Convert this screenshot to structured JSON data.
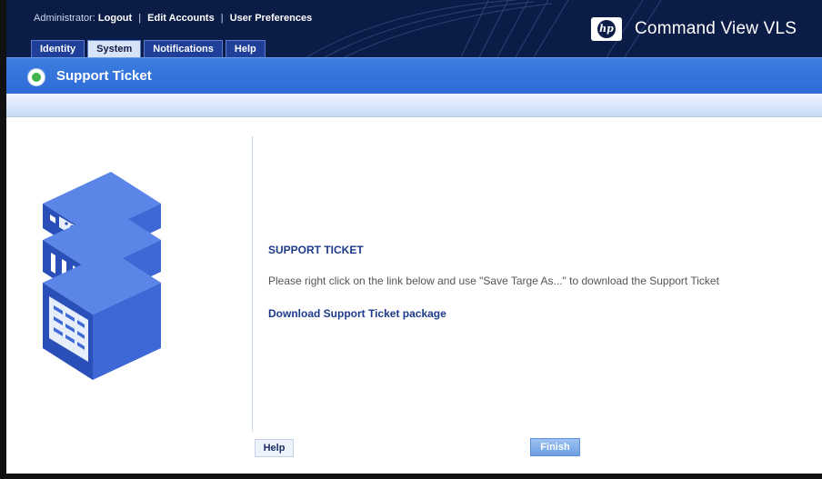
{
  "header": {
    "admin_prefix": "Administrator:",
    "links": [
      "Logout",
      "Edit Accounts",
      "User Preferences"
    ],
    "separator": "|",
    "logo_text": "hp",
    "product_name": "Command View VLS"
  },
  "tabs": [
    {
      "label": "Identity",
      "active": false
    },
    {
      "label": "System",
      "active": true
    },
    {
      "label": "Notifications",
      "active": false
    },
    {
      "label": "Help",
      "active": false
    }
  ],
  "page": {
    "title": "Support Ticket",
    "title_icon": "green-status-icon"
  },
  "content": {
    "heading": "SUPPORT TICKET",
    "instruction": "Please right click on the link below and use \"Save Targe As...\" to download the Support Ticket",
    "download_link": "Download Support Ticket package"
  },
  "buttons": {
    "help": "Help",
    "finish": "Finish"
  },
  "colors": {
    "header_bg": "#0b1c46",
    "title_bar": "#2f6ad6",
    "link_blue": "#1e3a8a",
    "server_blue": "#2d55c0"
  },
  "illustration": {
    "icon": "server-stack-icon"
  }
}
